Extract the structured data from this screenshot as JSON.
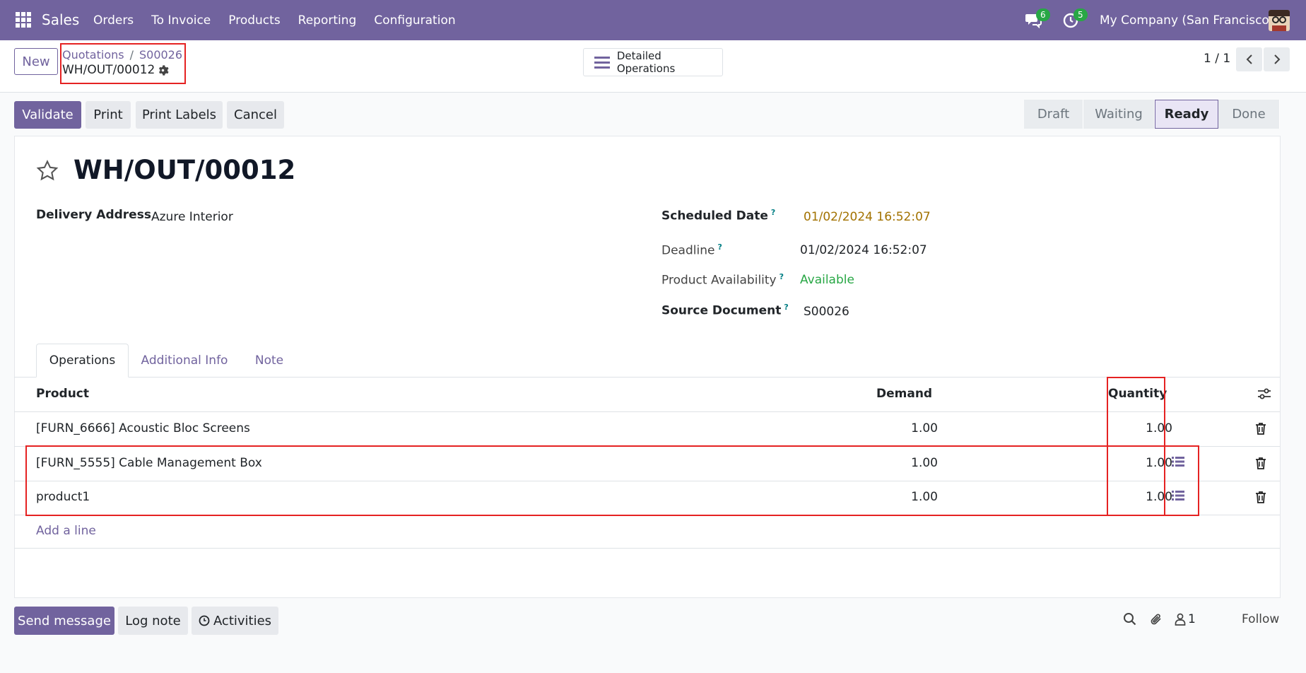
{
  "navbar": {
    "app_name": "Sales",
    "menu": [
      "Orders",
      "To Invoice",
      "Products",
      "Reporting",
      "Configuration"
    ],
    "messages_count": "6",
    "activities_count": "5",
    "company": "My Company (San Francisco)"
  },
  "control_panel": {
    "new_label": "New",
    "breadcrumb_parent": "Quotations",
    "breadcrumb_sep": "/",
    "breadcrumb_current": "S00026",
    "record_ref": "WH/OUT/00012",
    "detailed_operations_label": "Detailed Operations",
    "pager": "1 / 1"
  },
  "status_bar": {
    "buttons": {
      "validate": "Validate",
      "print": "Print",
      "print_labels": "Print Labels",
      "cancel": "Cancel"
    },
    "stages": [
      "Draft",
      "Waiting",
      "Ready",
      "Done"
    ],
    "active_stage": "Ready"
  },
  "record": {
    "title": "WH/OUT/00012",
    "delivery_address_label": "Delivery Address",
    "delivery_address": "Azure Interior",
    "scheduled_date_label": "Scheduled Date",
    "scheduled_date": "01/02/2024 16:52:07",
    "deadline_label": "Deadline",
    "deadline": "01/02/2024 16:52:07",
    "availability_label": "Product Availability",
    "availability": "Available",
    "source_document_label": "Source Document",
    "source_document": "S00026",
    "help_mark": "?"
  },
  "tabs": [
    "Operations",
    "Additional Info",
    "Note"
  ],
  "operations": {
    "columns": {
      "product": "Product",
      "demand": "Demand",
      "quantity": "Quantity"
    },
    "rows": [
      {
        "product": "[FURN_6666] Acoustic Bloc Screens",
        "demand": "1.00",
        "quantity": "1.00"
      },
      {
        "product": "[FURN_5555] Cable Management Box",
        "demand": "1.00",
        "quantity": "1.00"
      },
      {
        "product": "product1",
        "demand": "1.00",
        "quantity": "1.00"
      }
    ],
    "add_line": "Add a line"
  },
  "chatter": {
    "send_message": "Send message",
    "log_note": "Log note",
    "activities": "Activities",
    "followers_count": "1",
    "follow": "Follow"
  },
  "colors": {
    "brand": "#71639e",
    "annotation_red": "#e52222",
    "available_green": "#28a745",
    "date_warning": "#a27200"
  }
}
